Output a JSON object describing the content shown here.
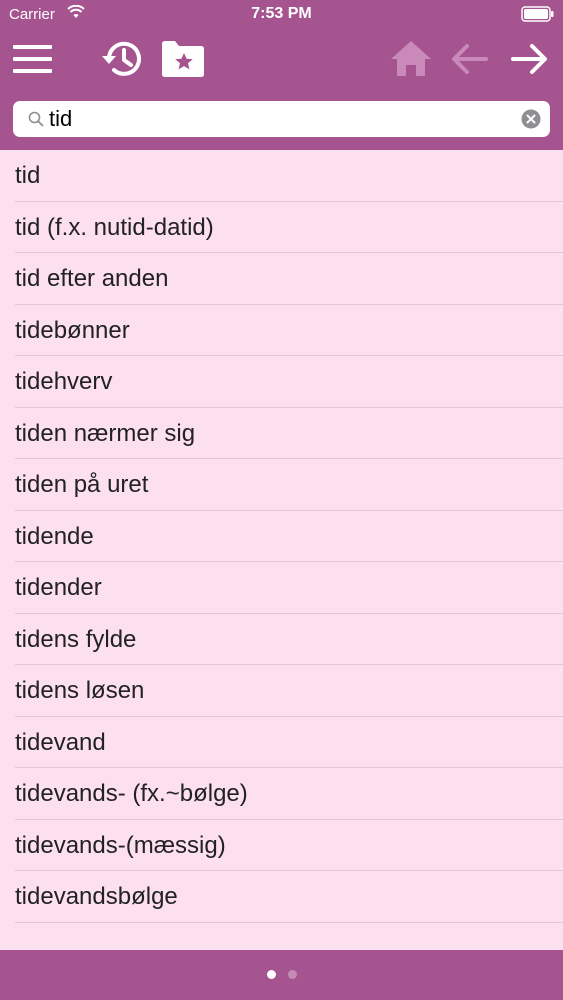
{
  "status_bar": {
    "carrier": "Carrier",
    "time": "7:53 PM"
  },
  "toolbar": {
    "icons": [
      "menu-icon",
      "history-icon",
      "favorites-folder-icon",
      "home-icon",
      "arrow-left-icon",
      "arrow-right-icon"
    ]
  },
  "search": {
    "value": "tid",
    "placeholder": ""
  },
  "results": [
    "tid",
    "tid (f.x. nutid-datid)",
    "tid efter anden",
    "tidebønner",
    "tidehverv",
    "tiden nærmer sig",
    "tiden på uret",
    "tidende",
    "tidender",
    "tidens fylde",
    "tidens løsen",
    "tidevand",
    "tidevands- (fx.~bølge)",
    "tidevands-(mæssig)",
    "tidevandsbølge"
  ],
  "pagination": {
    "pages": 2,
    "current": 1
  },
  "colors": {
    "bar": "#a6548f",
    "list_background": "#fde0f0",
    "divider": "#e6c4d6",
    "disabled_icon": "#c98ab9"
  }
}
